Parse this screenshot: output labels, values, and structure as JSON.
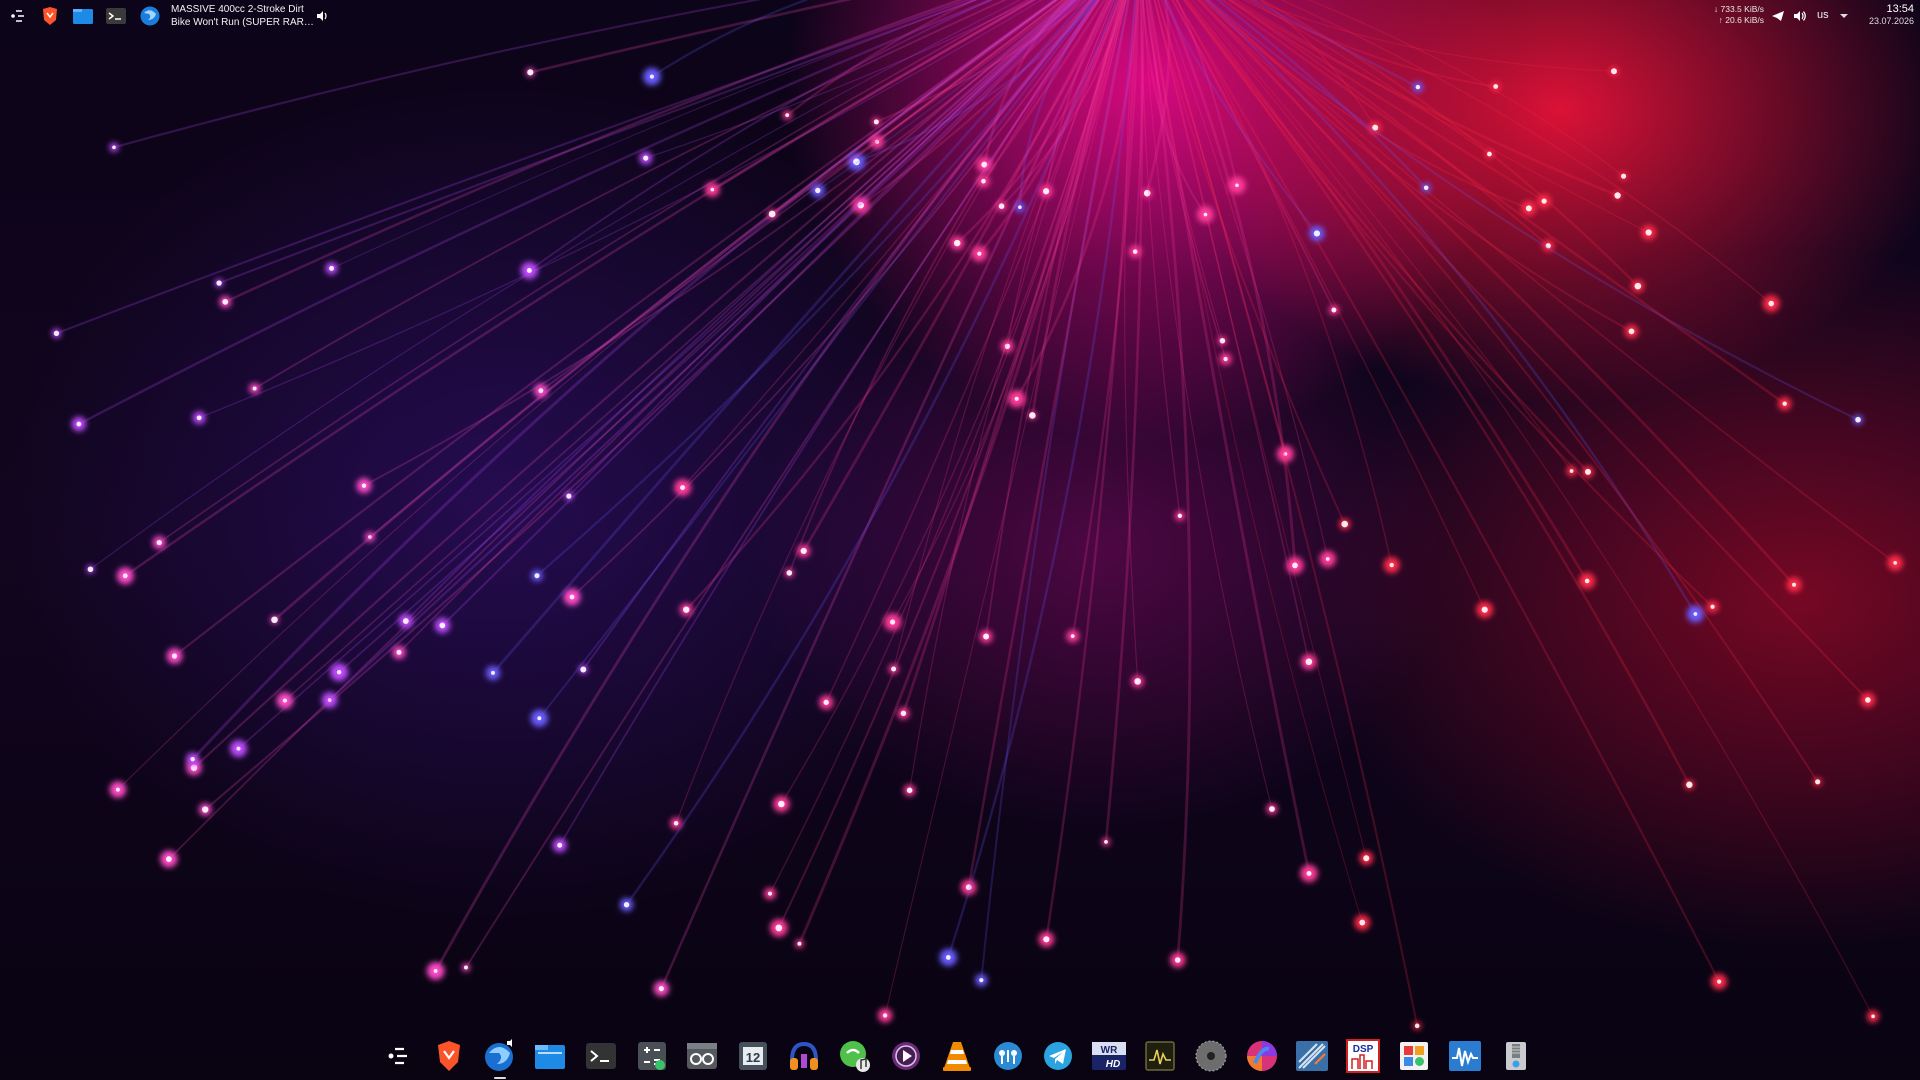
{
  "top_panel": {
    "task_title_line1": "MASSIVE 400cc 2-Stroke Dirt",
    "task_title_line2": "Bike Won't Run (SUPER RARE ...",
    "net_down": "↓ 733.5 KiB/s",
    "net_up": "↑ 20.6 KiB/s",
    "keyboard_layout": "us",
    "clock_time": "13:54",
    "clock_date": "23.07.2026"
  },
  "icons": {
    "top_panel": [
      "app-launcher-icon",
      "brave-browser-icon",
      "file-manager-icon",
      "terminal-icon",
      "firefox-icon",
      "volume-icon",
      "telegram-tray-icon",
      "volume-tray-icon",
      "tray-expand-icon"
    ],
    "dock": [
      "app-launcher-icon",
      "brave-browser-icon",
      "firefox-icon",
      "file-manager-icon",
      "terminal-icon",
      "calculator-icon",
      "tape-recorder-icon",
      "calendar-icon",
      "headphones-app-icon",
      "music-player-icon",
      "media-player-icon",
      "vlc-icon",
      "network-app-icon",
      "telegram-icon",
      "hd-video-icon",
      "system-monitor-icon",
      "disc-burner-icon",
      "color-picker-icon",
      "tools-icon",
      "dsp-app-icon",
      "software-center-icon",
      "waveform-app-icon",
      "archive-icon"
    ]
  },
  "colors": {
    "wallpaper_magenta": "#f00a8c",
    "wallpaper_red": "#ff143c",
    "wallpaper_purple": "#3c148c"
  }
}
